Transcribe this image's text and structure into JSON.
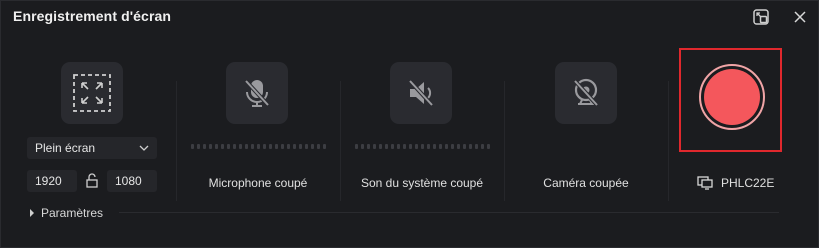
{
  "window": {
    "title": "Enregistrement d'écran"
  },
  "capture": {
    "mode": "Plein écran",
    "width": "1920",
    "height": "1080"
  },
  "microphone": {
    "label": "Microphone coupé",
    "level": 0
  },
  "system_audio": {
    "label": "Son du système coupé",
    "level": 0
  },
  "camera": {
    "label": "Caméra coupée"
  },
  "monitor": {
    "name": "PHLC22E"
  },
  "settings": {
    "label": "Paramètres"
  },
  "colors": {
    "record": "#f4575c",
    "highlight": "#e0282d",
    "tile": "#2a2b30"
  }
}
